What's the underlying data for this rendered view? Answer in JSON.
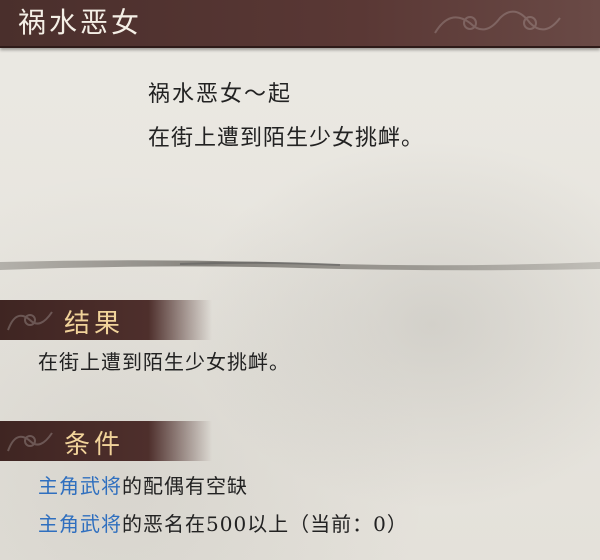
{
  "window_title": "祸水恶女",
  "event": {
    "title": "祸水恶女～起",
    "description": "在街上遭到陌生少女挑衅。"
  },
  "result": {
    "header": "结果",
    "text": "在街上遭到陌生少女挑衅。"
  },
  "conditions": {
    "header": "条件",
    "items": [
      {
        "link": "主角武将",
        "text": "的配偶有空缺"
      },
      {
        "link": "主角武将",
        "text": "的恶名在500以上（当前：0）"
      }
    ]
  },
  "colors": {
    "banner": "#4a2f2c",
    "header_text": "#f1d39a",
    "link": "#2f6fbf"
  }
}
